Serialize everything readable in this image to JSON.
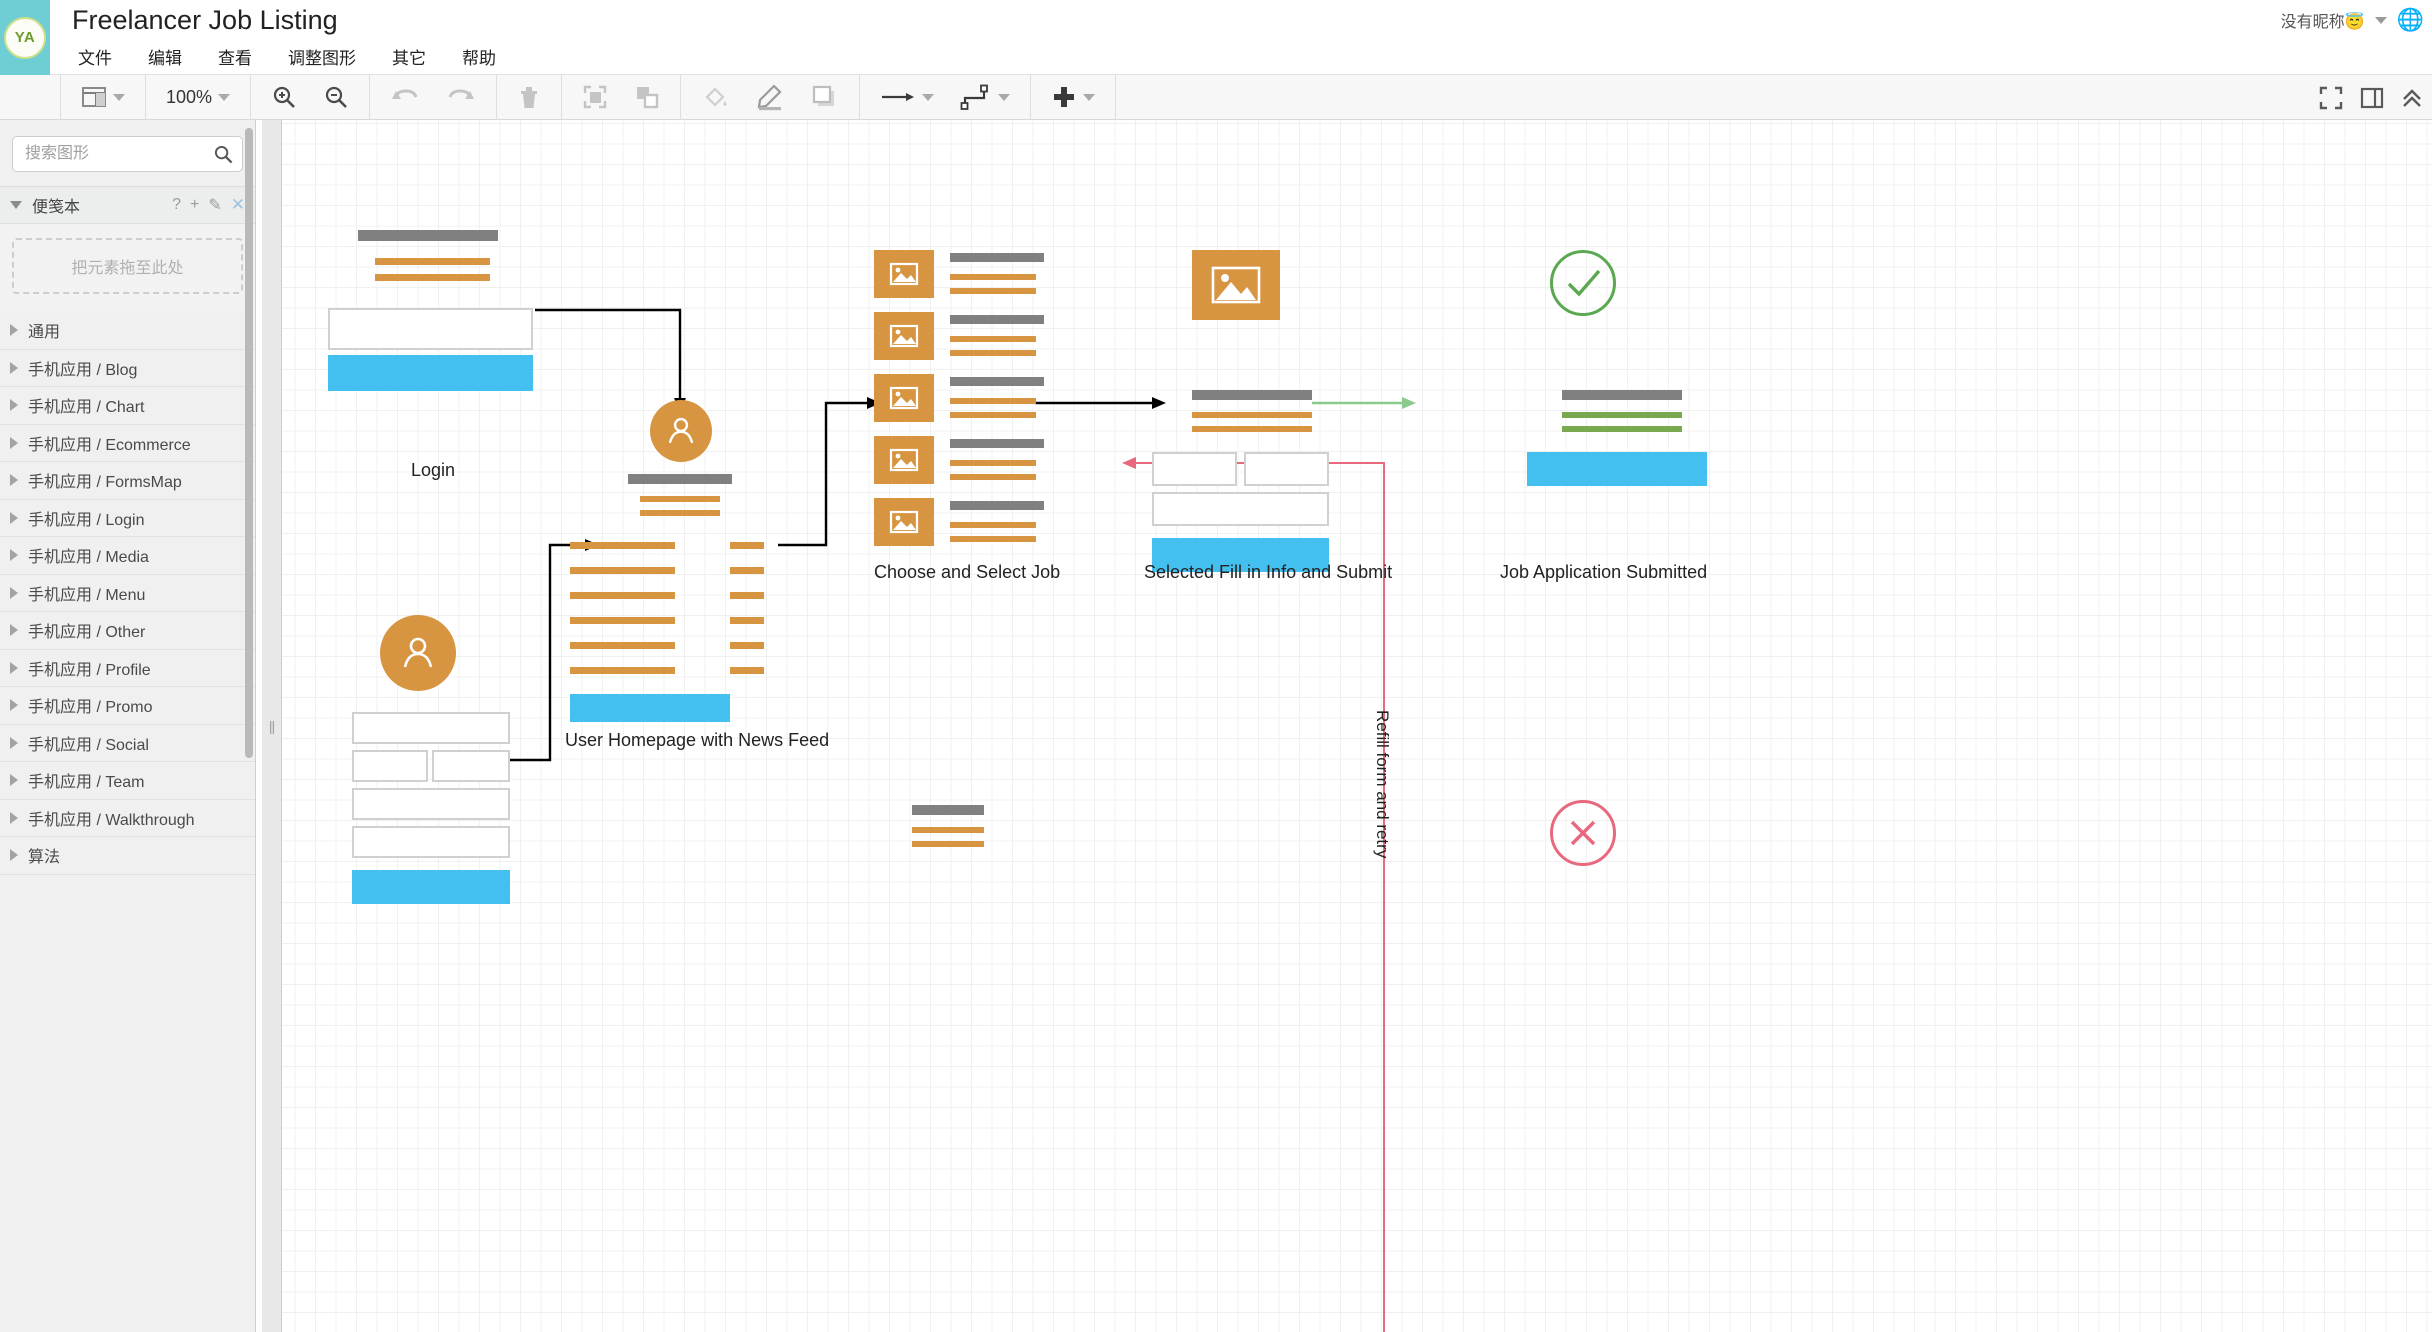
{
  "app": {
    "logo_text": "YA",
    "document_title": "Freelancer Job Listing",
    "menus": [
      {
        "label": "文件",
        "name": "file"
      },
      {
        "label": "编辑",
        "name": "edit"
      },
      {
        "label": "查看",
        "name": "view"
      },
      {
        "label": "调整图形",
        "name": "arrange"
      },
      {
        "label": "其它",
        "name": "extras"
      },
      {
        "label": "帮助",
        "name": "help"
      }
    ],
    "user": {
      "name": "没有昵称😇"
    },
    "colors": {
      "brand_teal": "#6fcdd4",
      "logo_green": "#6e9b2e",
      "accent_orange": "#d79541",
      "accent_blue": "#44c0f0",
      "accent_gray": "#808080",
      "accent_green": "#7aa84f",
      "error_red": "#e8697d",
      "flow_green": "#8cc98c"
    }
  },
  "toolbar": {
    "layout_label": "",
    "zoom_label": "100%",
    "buttons": [
      {
        "name": "layout-picker",
        "icon": "layout-icon"
      },
      {
        "name": "zoom-level",
        "icon": "chevron-down-icon"
      },
      {
        "name": "zoom-in",
        "icon": "zoom-in-icon"
      },
      {
        "name": "zoom-out",
        "icon": "zoom-out-icon"
      },
      {
        "name": "undo",
        "icon": "undo-icon"
      },
      {
        "name": "redo",
        "icon": "redo-icon"
      },
      {
        "name": "delete",
        "icon": "trash-icon"
      },
      {
        "name": "bring-to-front",
        "icon": "bring-front-icon"
      },
      {
        "name": "send-to-back",
        "icon": "send-back-icon"
      },
      {
        "name": "fill-color",
        "icon": "paint-bucket-icon"
      },
      {
        "name": "line-color",
        "icon": "pencil-icon"
      },
      {
        "name": "shadow",
        "icon": "square-shadow-icon"
      },
      {
        "name": "connector-arrow",
        "icon": "arrow-icon"
      },
      {
        "name": "waypoints",
        "icon": "waypoint-icon"
      },
      {
        "name": "insert",
        "icon": "plus-icon"
      },
      {
        "name": "fullscreen",
        "icon": "fullscreen-icon"
      },
      {
        "name": "format-panel",
        "icon": "panel-icon"
      },
      {
        "name": "collapse-toolbar",
        "icon": "chevrons-up-icon"
      }
    ]
  },
  "sidebar": {
    "search": {
      "placeholder": "搜索图形",
      "value": ""
    },
    "scratchpad": {
      "title": "便笺本",
      "drop_hint": "把元素拖至此处",
      "actions": [
        {
          "name": "help",
          "glyph": "?"
        },
        {
          "name": "add",
          "glyph": "+"
        },
        {
          "name": "edit",
          "glyph": "✎"
        },
        {
          "name": "close",
          "glyph": "✕"
        }
      ]
    },
    "shape_groups": [
      {
        "label": "通用"
      },
      {
        "label": "手机应用 / Blog"
      },
      {
        "label": "手机应用 / Chart"
      },
      {
        "label": "手机应用 / Ecommerce"
      },
      {
        "label": "手机应用 / FormsMap"
      },
      {
        "label": "手机应用 / Login"
      },
      {
        "label": "手机应用 / Media"
      },
      {
        "label": "手机应用 / Menu"
      },
      {
        "label": "手机应用 / Other"
      },
      {
        "label": "手机应用 / Profile"
      },
      {
        "label": "手机应用 / Promo"
      },
      {
        "label": "手机应用 / Social"
      },
      {
        "label": "手机应用 / Team"
      },
      {
        "label": "手机应用 / Walkthrough"
      },
      {
        "label": "算法"
      }
    ]
  },
  "canvas": {
    "labels": {
      "login": "Login",
      "homepage": "User Homepage with News Feed",
      "choose_job": "Choose and Select Job",
      "fill_info": "Selected Fill in Info and Submit",
      "submitted": "Job Application Submitted",
      "retry": "Refill form and retry"
    }
  }
}
